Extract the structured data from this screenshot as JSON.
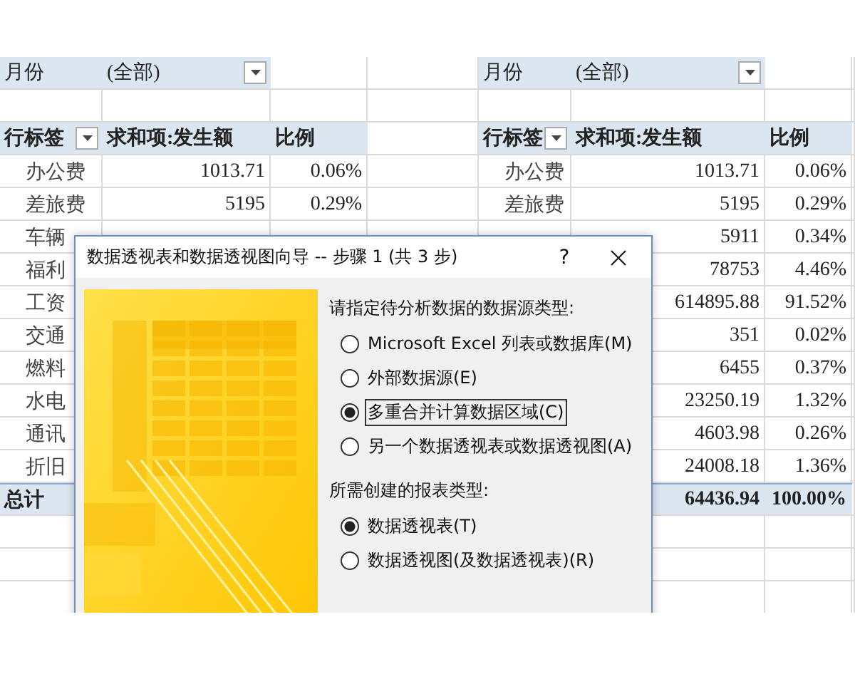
{
  "pivot_tables": [
    {
      "filter": {
        "label": "月份",
        "value": "(全部)"
      },
      "columns": [
        "行标签",
        "求和项:发生额",
        "比例"
      ],
      "rows": [
        {
          "label": "办公费",
          "amount": "1013.71",
          "ratio": "0.06%"
        },
        {
          "label": "差旅费",
          "amount": "5195",
          "ratio": "0.29%"
        },
        {
          "label": "车辆"
        },
        {
          "label": "福利"
        },
        {
          "label": "工资"
        },
        {
          "label": "交通"
        },
        {
          "label": "燃料"
        },
        {
          "label": "水电"
        },
        {
          "label": "通讯"
        },
        {
          "label": "折旧"
        }
      ],
      "total": {
        "label": "总计"
      }
    },
    {
      "filter": {
        "label": "月份",
        "value": "(全部)"
      },
      "columns": [
        "行标签",
        "求和项:发生额",
        "比例"
      ],
      "rows": [
        {
          "label": "办公费",
          "amount": "1013.71",
          "ratio": "0.06%"
        },
        {
          "label": "差旅费",
          "amount": "5195",
          "ratio": "0.29%"
        },
        {
          "amount": "5911",
          "ratio": "0.34%"
        },
        {
          "amount": "78753",
          "ratio": "4.46%"
        },
        {
          "amount": "614895.88",
          "ratio": "91.52%"
        },
        {
          "amount": "351",
          "ratio": "0.02%"
        },
        {
          "amount": "6455",
          "ratio": "0.37%"
        },
        {
          "amount": "23250.19",
          "ratio": "1.32%"
        },
        {
          "amount": "4603.98",
          "ratio": "0.26%"
        },
        {
          "amount": "24008.18",
          "ratio": "1.36%"
        }
      ],
      "total": {
        "amount": "64436.94",
        "ratio": "100.00%"
      }
    }
  ],
  "dialog": {
    "title": "数据透视表和数据透视图向导 -- 步骤 1 (共 3 步)",
    "help": "?",
    "sections": [
      {
        "heading": "请指定待分析数据的数据源类型:",
        "options": [
          {
            "label": "Microsoft Excel 列表或数据库(M)",
            "selected": false,
            "focused": false
          },
          {
            "label": "外部数据源(E)",
            "selected": false,
            "focused": false
          },
          {
            "label": "多重合并计算数据区域(C)",
            "selected": true,
            "focused": true
          },
          {
            "label": "另一个数据透视表或数据透视图(A)",
            "selected": false,
            "focused": false
          }
        ]
      },
      {
        "heading": "所需创建的报表类型:",
        "options": [
          {
            "label": "数据透视表(T)",
            "selected": true,
            "focused": false
          },
          {
            "label": "数据透视图(及数据透视表)(R)",
            "selected": false,
            "focused": false
          }
        ]
      }
    ]
  }
}
